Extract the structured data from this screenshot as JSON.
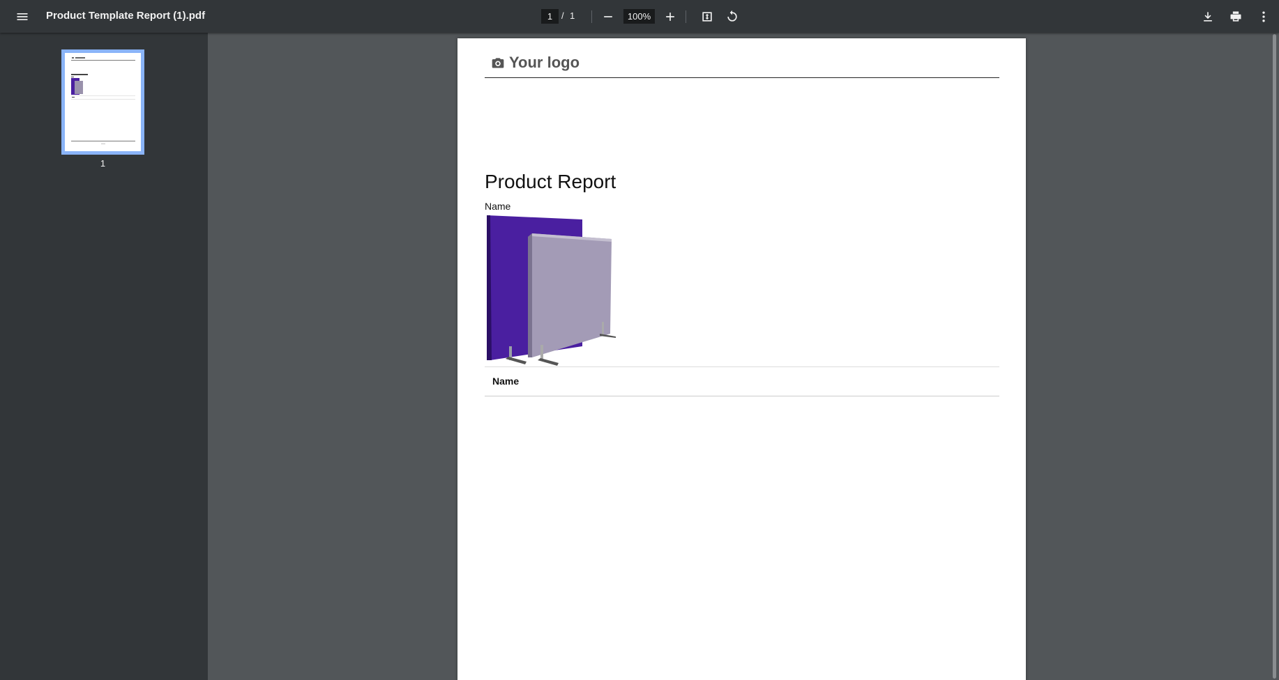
{
  "toolbar": {
    "title": "Product Template Report (1).pdf",
    "current_page": "1",
    "page_separator": "/",
    "total_pages": "1",
    "zoom": "100%",
    "icons": [
      "menu-icon",
      "zoom-out-icon",
      "zoom-in-icon",
      "fit-page-icon",
      "rotate-icon",
      "download-icon",
      "print-icon",
      "more-vert-icon"
    ]
  },
  "sidebar": {
    "thumbnails": [
      {
        "label": "1"
      }
    ]
  },
  "document": {
    "logo_text": "Your logo",
    "report_title": "Product Report",
    "field_label": "Name",
    "table": {
      "columns": [
        "Name"
      ]
    }
  },
  "colors": {
    "toolbar_bg": "#323639",
    "viewer_bg": "#525659",
    "thumb_highlight": "#8ab4f8",
    "product_purple": "#4a1fa0",
    "product_grey": "#9a92ac"
  }
}
